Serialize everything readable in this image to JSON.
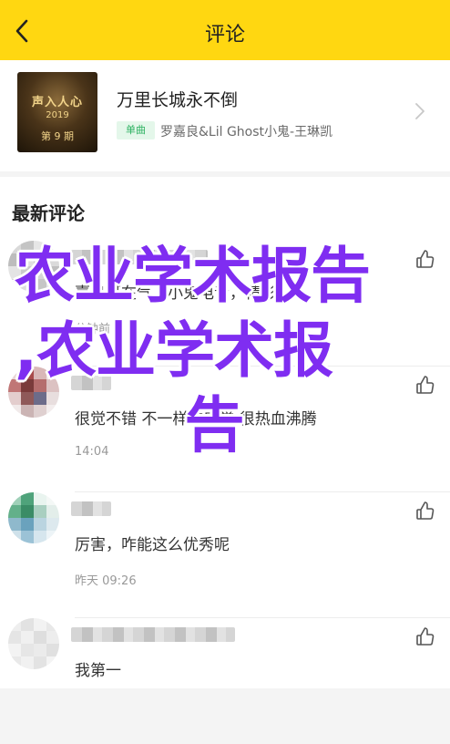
{
  "header": {
    "title": "评论"
  },
  "song": {
    "title": "万里长城永不倒",
    "tag": "单曲",
    "artist": "罗嘉良&Lil Ghost小鬼-王琳凯",
    "cover": {
      "logo_text": "声入人心",
      "year": "2019",
      "episode": "第 9 期"
    }
  },
  "comments_section": {
    "title": "最新评论"
  },
  "comments": [
    {
      "text": "嘉良哥在气，小鬼电音，精彩",
      "time": "分钟前"
    },
    {
      "text": "很觉不错 不一样的感觉 很热血沸腾",
      "time": "14:04"
    },
    {
      "text": "厉害，咋能这么优秀呢",
      "time": "昨天 09:26"
    },
    {
      "text": "我第一",
      "time": ""
    }
  ],
  "watermark": {
    "line1": "农业学术报告",
    "line2": ",农业学术报",
    "line3": "告"
  },
  "colors": {
    "accent": "#ffd711",
    "tag_green": "#2db261",
    "watermark": "#7f2df1"
  }
}
